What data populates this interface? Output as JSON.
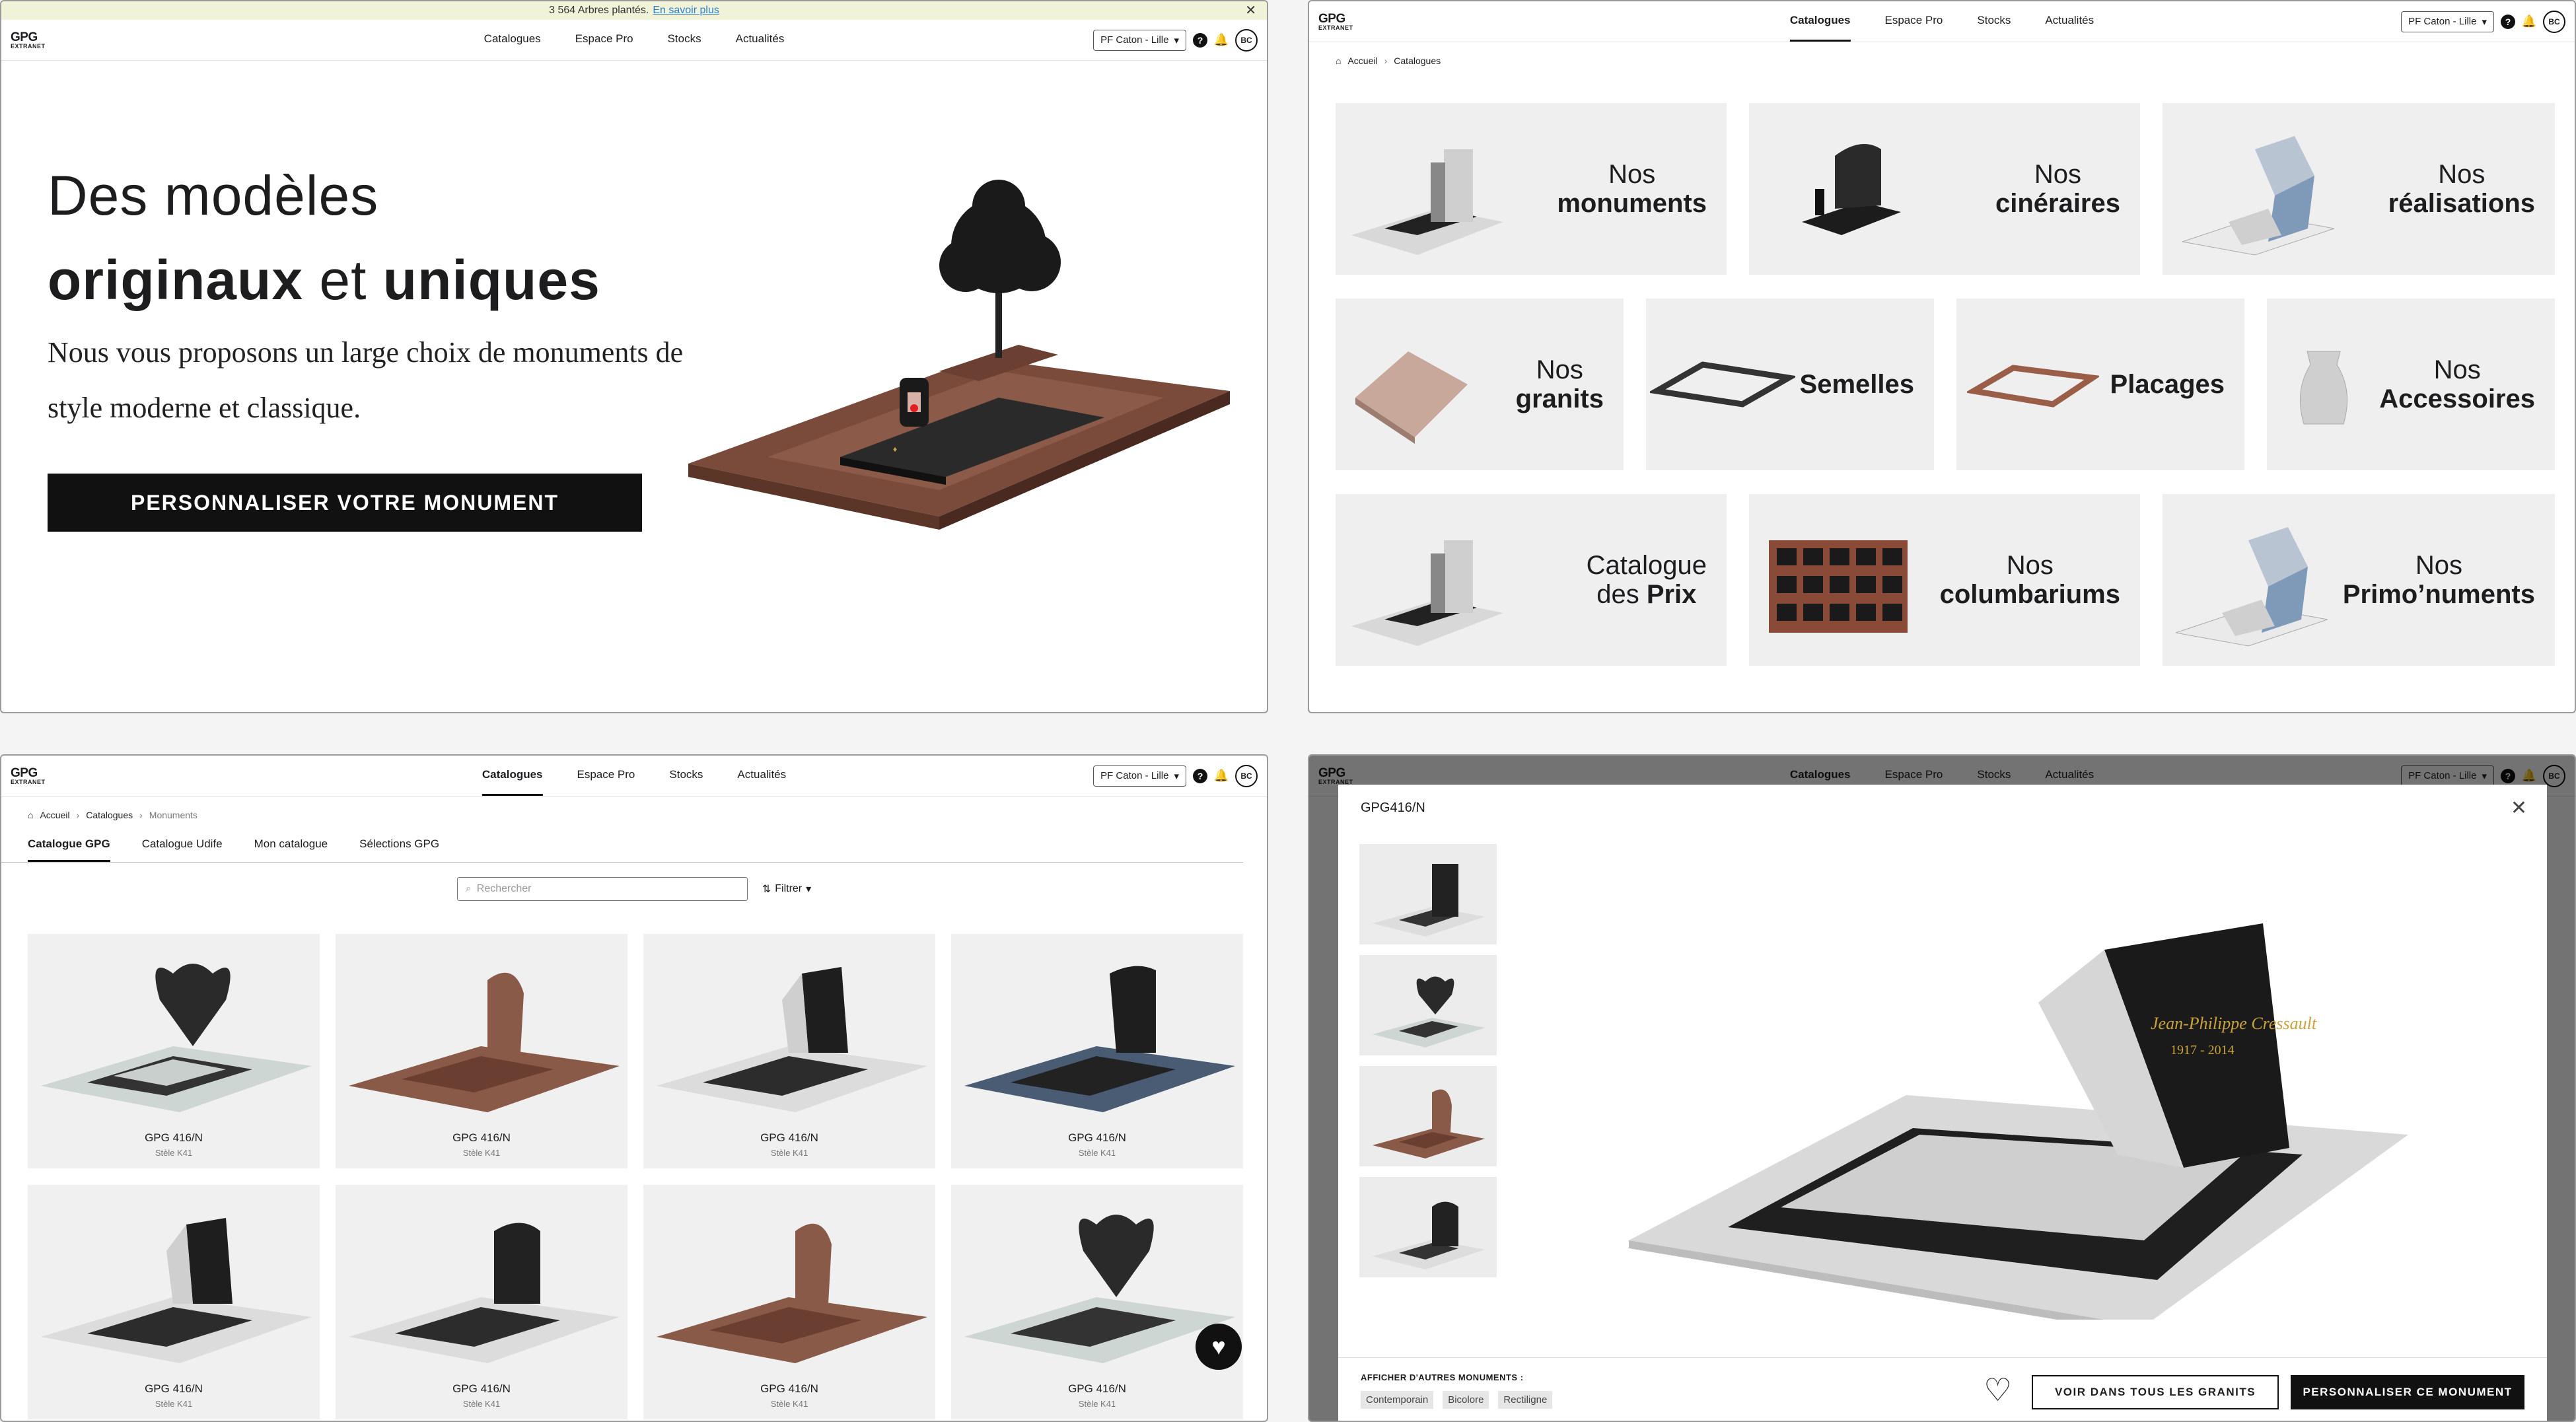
{
  "nav": {
    "logo_line1": "GPG",
    "logo_line2": "EXTRANET",
    "items": [
      "Catalogues",
      "Espace Pro",
      "Stocks",
      "Actualités"
    ],
    "selector": "PF Caton - Lille",
    "help": "?",
    "avatar": "BC"
  },
  "banner": {
    "text": "3 564 Arbres plantés.",
    "link": "En savoir plus",
    "close": "✕"
  },
  "hero": {
    "line1": "Des modèles",
    "line2_a": "originaux",
    "line2_b": " et ",
    "line2_c": "uniques",
    "sub": "Nous vous proposons un large choix de monuments de style moderne et classique.",
    "cta": "PERSONNALISER VOTRE MONUMENT"
  },
  "catalogues_page": {
    "crumbs": [
      "Accueil",
      "Catalogues"
    ],
    "tiles": [
      {
        "l1": "Nos",
        "l2": "monuments"
      },
      {
        "l1": "Nos",
        "l2": "cinéraires"
      },
      {
        "l1": "Nos",
        "l2": "réalisations"
      },
      {
        "l1": "Nos",
        "l2": "granits"
      },
      {
        "l1": "",
        "l2": "Semelles"
      },
      {
        "l1": "",
        "l2": "Placages"
      },
      {
        "l1": "Nos",
        "l2": "Accessoires"
      },
      {
        "l1": "Catalogue",
        "l1b": "des ",
        "l2": "Prix"
      },
      {
        "l1": "Nos",
        "l2": "columbariums"
      },
      {
        "l1": "Nos",
        "l2": "Primo’numents"
      }
    ]
  },
  "monuments_page": {
    "crumbs": [
      "Accueil",
      "Catalogues",
      "Monuments"
    ],
    "tabs": [
      "Catalogue GPG",
      "Catalogue Udife",
      "Mon catalogue",
      "Sélections GPG"
    ],
    "search_placeholder": "Rechercher",
    "filter": "Filtrer",
    "cards": [
      {
        "name": "GPG 416/N",
        "sub": "Stèle K41"
      },
      {
        "name": "GPG 416/N",
        "sub": "Stèle K41"
      },
      {
        "name": "GPG 416/N",
        "sub": "Stèle K41"
      },
      {
        "name": "GPG 416/N",
        "sub": "Stèle K41"
      },
      {
        "name": "GPG 416/N",
        "sub": "Stèle K41"
      },
      {
        "name": "GPG 416/N",
        "sub": "Stèle K41"
      },
      {
        "name": "GPG 416/N",
        "sub": "Stèle K41"
      },
      {
        "name": "GPG 416/N",
        "sub": "Stèle K41"
      }
    ]
  },
  "modal": {
    "title": "GPG416/N",
    "close": "✕",
    "other_label": "AFFICHER D'AUTRES MONUMENTS :",
    "chips": [
      "Contemporain",
      "Bicolore",
      "Rectiligne"
    ],
    "btn_all_granits": "VOIR DANS TOUS LES GRANITS",
    "btn_customize": "PERSONNALISER CE MONUMENT",
    "engraving_name": "Jean-Philippe Cressault",
    "engraving_dates": "1917 - 2014"
  }
}
